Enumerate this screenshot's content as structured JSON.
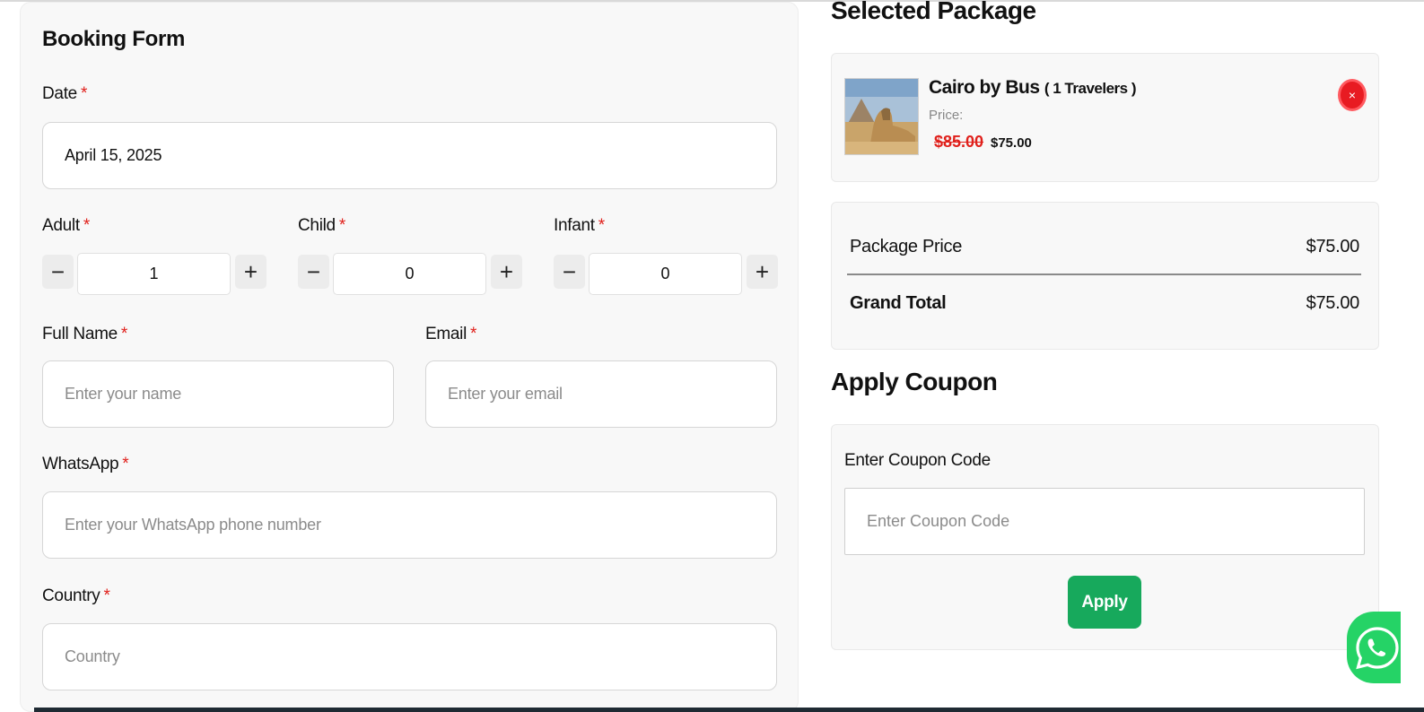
{
  "booking_form": {
    "title": "Booking Form",
    "required_mark": "*",
    "date": {
      "label": "Date",
      "value": "April 15, 2025"
    },
    "adult": {
      "label": "Adult",
      "value": "1",
      "minus": "−",
      "plus": "+"
    },
    "child": {
      "label": "Child",
      "value": "0",
      "minus": "−",
      "plus": "+"
    },
    "infant": {
      "label": "Infant",
      "value": "0",
      "minus": "−",
      "plus": "+"
    },
    "full_name": {
      "label": "Full Name",
      "placeholder": "Enter your name"
    },
    "email": {
      "label": "Email",
      "placeholder": "Enter your email"
    },
    "whatsapp": {
      "label": "WhatsApp",
      "placeholder": "Enter your WhatsApp phone number"
    },
    "country": {
      "label": "Country",
      "placeholder": "Country"
    }
  },
  "selected_package": {
    "title": "Selected Package",
    "name": "Cairo by Bus",
    "travelers": "( 1 Travelers )",
    "price_label": "Price:",
    "old_price": "$85.00",
    "new_price": "$75.00",
    "remove_icon": "close-icon",
    "remove_symbol": "×"
  },
  "summary": {
    "package_price_label": "Package Price",
    "package_price_value": "$75.00",
    "grand_total_label": "Grand Total",
    "grand_total_value": "$75.00"
  },
  "coupon": {
    "title": "Apply Coupon",
    "label": "Enter Coupon Code",
    "placeholder": "Enter Coupon Code",
    "apply_label": "Apply"
  },
  "colors": {
    "required": "#e0201b",
    "apply_button": "#17a95c",
    "remove_button": "#e81b22",
    "whatsapp": "#25d366"
  },
  "whatsapp_icon": "whatsapp-icon"
}
